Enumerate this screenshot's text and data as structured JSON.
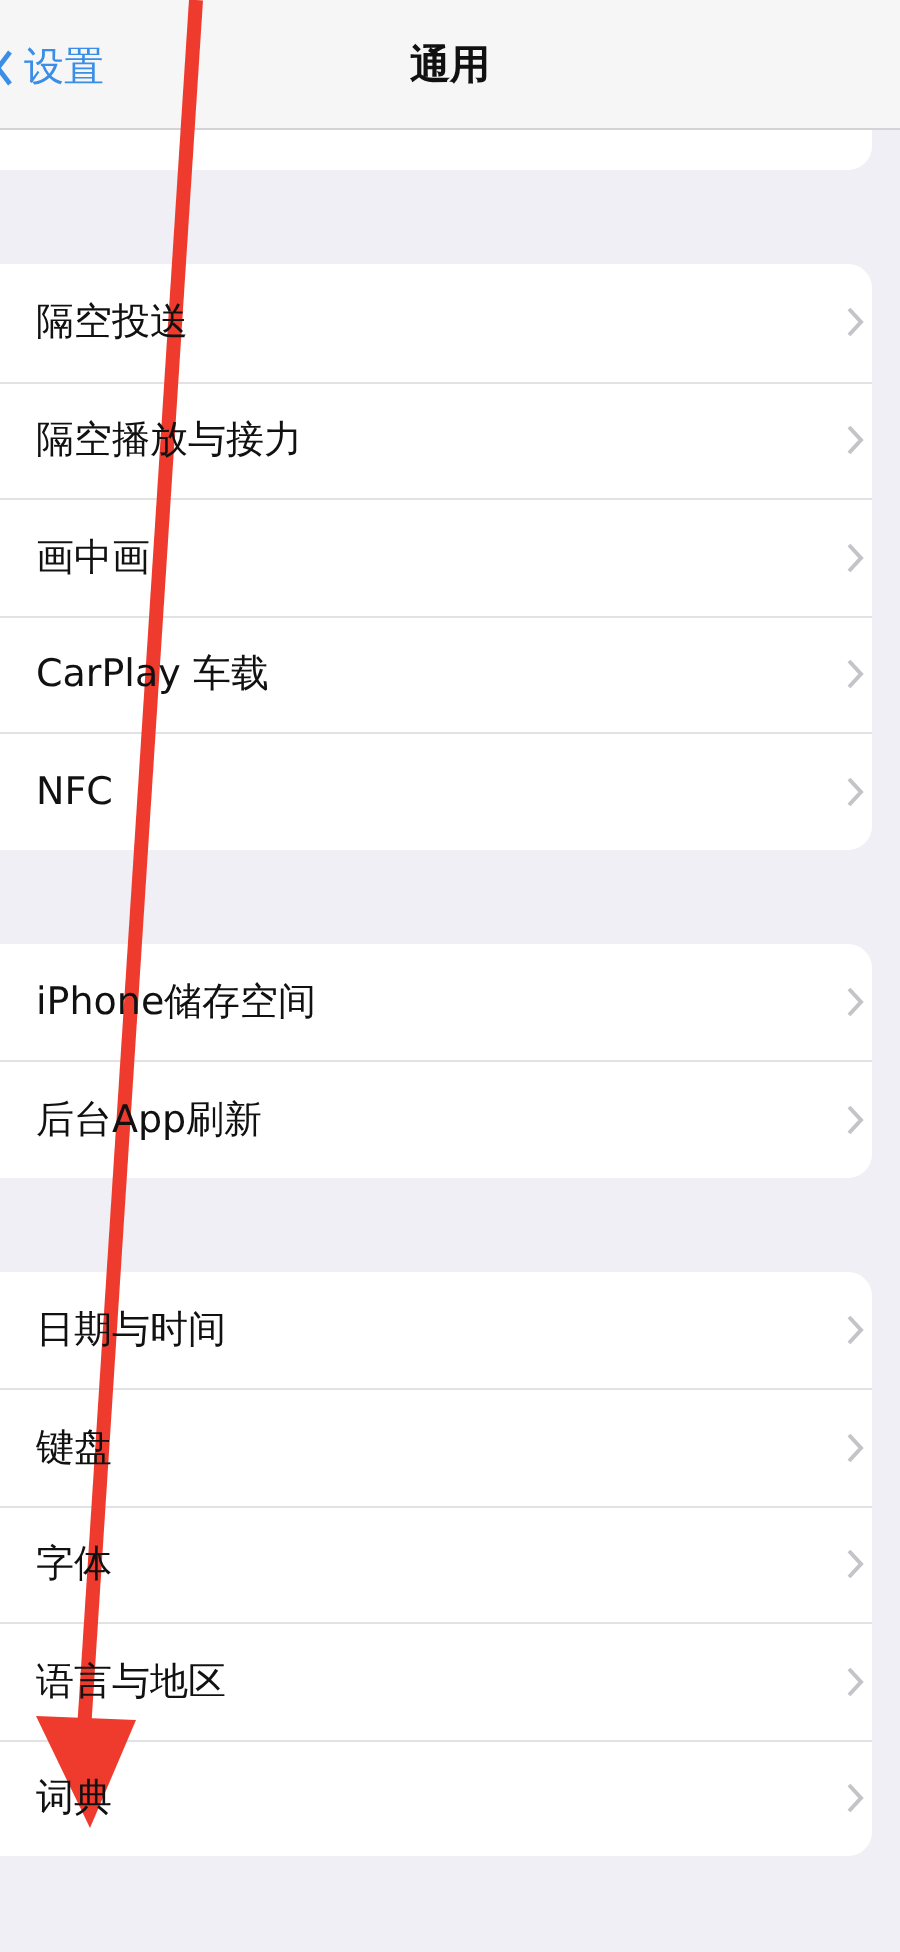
{
  "nav": {
    "back": "设置",
    "title": "通用"
  },
  "groups": [
    {
      "items": [
        {
          "label": "隔空投送"
        },
        {
          "label": "隔空播放与接力"
        },
        {
          "label": "画中画"
        },
        {
          "label": "CarPlay 车载"
        },
        {
          "label": "NFC"
        }
      ]
    },
    {
      "items": [
        {
          "label": "iPhone储存空间"
        },
        {
          "label": "后台App刷新"
        }
      ]
    },
    {
      "items": [
        {
          "label": "日期与时间"
        },
        {
          "label": "键盘"
        },
        {
          "label": "字体"
        },
        {
          "label": "语言与地区"
        },
        {
          "label": "词典"
        }
      ]
    }
  ]
}
